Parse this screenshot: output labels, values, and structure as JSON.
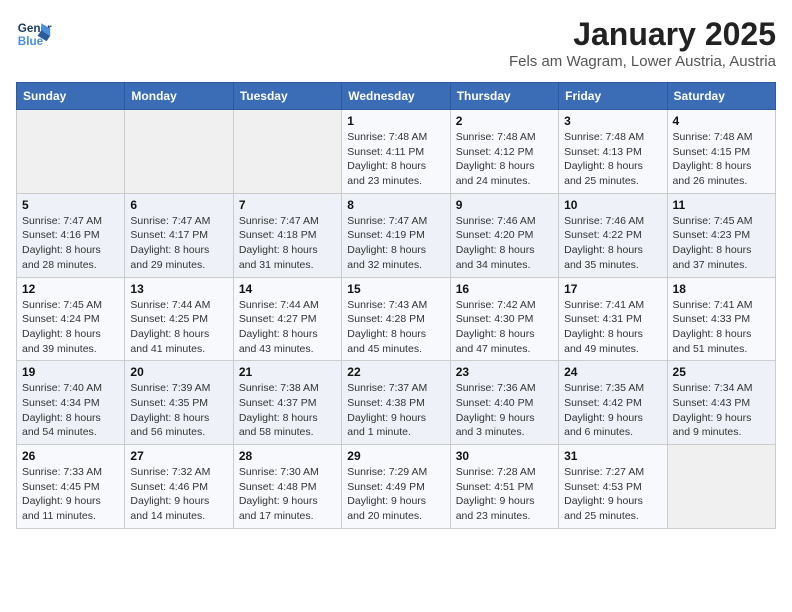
{
  "logo": {
    "line1": "General",
    "line2": "Blue"
  },
  "title": "January 2025",
  "subtitle": "Fels am Wagram, Lower Austria, Austria",
  "weekdays": [
    "Sunday",
    "Monday",
    "Tuesday",
    "Wednesday",
    "Thursday",
    "Friday",
    "Saturday"
  ],
  "weeks": [
    [
      {
        "day": "",
        "info": ""
      },
      {
        "day": "",
        "info": ""
      },
      {
        "day": "",
        "info": ""
      },
      {
        "day": "1",
        "info": "Sunrise: 7:48 AM\nSunset: 4:11 PM\nDaylight: 8 hours\nand 23 minutes."
      },
      {
        "day": "2",
        "info": "Sunrise: 7:48 AM\nSunset: 4:12 PM\nDaylight: 8 hours\nand 24 minutes."
      },
      {
        "day": "3",
        "info": "Sunrise: 7:48 AM\nSunset: 4:13 PM\nDaylight: 8 hours\nand 25 minutes."
      },
      {
        "day": "4",
        "info": "Sunrise: 7:48 AM\nSunset: 4:15 PM\nDaylight: 8 hours\nand 26 minutes."
      }
    ],
    [
      {
        "day": "5",
        "info": "Sunrise: 7:47 AM\nSunset: 4:16 PM\nDaylight: 8 hours\nand 28 minutes."
      },
      {
        "day": "6",
        "info": "Sunrise: 7:47 AM\nSunset: 4:17 PM\nDaylight: 8 hours\nand 29 minutes."
      },
      {
        "day": "7",
        "info": "Sunrise: 7:47 AM\nSunset: 4:18 PM\nDaylight: 8 hours\nand 31 minutes."
      },
      {
        "day": "8",
        "info": "Sunrise: 7:47 AM\nSunset: 4:19 PM\nDaylight: 8 hours\nand 32 minutes."
      },
      {
        "day": "9",
        "info": "Sunrise: 7:46 AM\nSunset: 4:20 PM\nDaylight: 8 hours\nand 34 minutes."
      },
      {
        "day": "10",
        "info": "Sunrise: 7:46 AM\nSunset: 4:22 PM\nDaylight: 8 hours\nand 35 minutes."
      },
      {
        "day": "11",
        "info": "Sunrise: 7:45 AM\nSunset: 4:23 PM\nDaylight: 8 hours\nand 37 minutes."
      }
    ],
    [
      {
        "day": "12",
        "info": "Sunrise: 7:45 AM\nSunset: 4:24 PM\nDaylight: 8 hours\nand 39 minutes."
      },
      {
        "day": "13",
        "info": "Sunrise: 7:44 AM\nSunset: 4:25 PM\nDaylight: 8 hours\nand 41 minutes."
      },
      {
        "day": "14",
        "info": "Sunrise: 7:44 AM\nSunset: 4:27 PM\nDaylight: 8 hours\nand 43 minutes."
      },
      {
        "day": "15",
        "info": "Sunrise: 7:43 AM\nSunset: 4:28 PM\nDaylight: 8 hours\nand 45 minutes."
      },
      {
        "day": "16",
        "info": "Sunrise: 7:42 AM\nSunset: 4:30 PM\nDaylight: 8 hours\nand 47 minutes."
      },
      {
        "day": "17",
        "info": "Sunrise: 7:41 AM\nSunset: 4:31 PM\nDaylight: 8 hours\nand 49 minutes."
      },
      {
        "day": "18",
        "info": "Sunrise: 7:41 AM\nSunset: 4:33 PM\nDaylight: 8 hours\nand 51 minutes."
      }
    ],
    [
      {
        "day": "19",
        "info": "Sunrise: 7:40 AM\nSunset: 4:34 PM\nDaylight: 8 hours\nand 54 minutes."
      },
      {
        "day": "20",
        "info": "Sunrise: 7:39 AM\nSunset: 4:35 PM\nDaylight: 8 hours\nand 56 minutes."
      },
      {
        "day": "21",
        "info": "Sunrise: 7:38 AM\nSunset: 4:37 PM\nDaylight: 8 hours\nand 58 minutes."
      },
      {
        "day": "22",
        "info": "Sunrise: 7:37 AM\nSunset: 4:38 PM\nDaylight: 9 hours\nand 1 minute."
      },
      {
        "day": "23",
        "info": "Sunrise: 7:36 AM\nSunset: 4:40 PM\nDaylight: 9 hours\nand 3 minutes."
      },
      {
        "day": "24",
        "info": "Sunrise: 7:35 AM\nSunset: 4:42 PM\nDaylight: 9 hours\nand 6 minutes."
      },
      {
        "day": "25",
        "info": "Sunrise: 7:34 AM\nSunset: 4:43 PM\nDaylight: 9 hours\nand 9 minutes."
      }
    ],
    [
      {
        "day": "26",
        "info": "Sunrise: 7:33 AM\nSunset: 4:45 PM\nDaylight: 9 hours\nand 11 minutes."
      },
      {
        "day": "27",
        "info": "Sunrise: 7:32 AM\nSunset: 4:46 PM\nDaylight: 9 hours\nand 14 minutes."
      },
      {
        "day": "28",
        "info": "Sunrise: 7:30 AM\nSunset: 4:48 PM\nDaylight: 9 hours\nand 17 minutes."
      },
      {
        "day": "29",
        "info": "Sunrise: 7:29 AM\nSunset: 4:49 PM\nDaylight: 9 hours\nand 20 minutes."
      },
      {
        "day": "30",
        "info": "Sunrise: 7:28 AM\nSunset: 4:51 PM\nDaylight: 9 hours\nand 23 minutes."
      },
      {
        "day": "31",
        "info": "Sunrise: 7:27 AM\nSunset: 4:53 PM\nDaylight: 9 hours\nand 25 minutes."
      },
      {
        "day": "",
        "info": ""
      }
    ]
  ]
}
